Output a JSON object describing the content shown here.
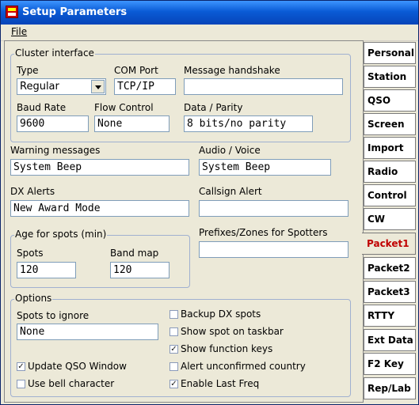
{
  "window": {
    "title": "Setup Parameters"
  },
  "menu": {
    "file": "File"
  },
  "cluster": {
    "group_label": "Cluster interface",
    "type_label": "Type",
    "type_value": "Regular",
    "com_label": "COM Port",
    "com_value": "TCP/IP",
    "handshake_label": "Message handshake",
    "handshake_value": "",
    "baud_label": "Baud Rate",
    "baud_value": "9600",
    "flow_label": "Flow Control",
    "flow_value": "None",
    "parity_label": "Data / Parity",
    "parity_value": "8 bits/no parity"
  },
  "warning": {
    "label": "Warning messages",
    "value": "System Beep"
  },
  "audio": {
    "label": "Audio / Voice",
    "value": "System Beep"
  },
  "dx_alerts": {
    "label": "DX Alerts",
    "value": "New Award Mode"
  },
  "callsign_alert": {
    "label": "Callsign Alert",
    "value": ""
  },
  "age": {
    "group_label": "Age for spots (min)",
    "spots_label": "Spots",
    "spots_value": "120",
    "bandmap_label": "Band map",
    "bandmap_value": "120"
  },
  "prefixes": {
    "label": "Prefixes/Zones for Spotters",
    "value": ""
  },
  "options": {
    "group_label": "Options",
    "ignore_label": "Spots to ignore",
    "ignore_value": "None",
    "backup": {
      "label": "Backup DX spots",
      "checked": false
    },
    "taskbar": {
      "label": "Show spot on taskbar",
      "checked": false
    },
    "function_keys": {
      "label": "Show function keys",
      "checked": true
    },
    "update_qso": {
      "label": "Update QSO Window",
      "checked": true
    },
    "alert_unconfirmed": {
      "label": "Alert unconfirmed country",
      "checked": false
    },
    "bell": {
      "label": "Use bell character",
      "checked": false
    },
    "last_freq": {
      "label": "Enable Last Freq",
      "checked": true
    }
  },
  "tabs": [
    "Personal",
    "Station",
    "QSO",
    "Screen",
    "Import",
    "Radio",
    "Control",
    "CW",
    "Packet1",
    "Packet2",
    "Packet3",
    "RTTY",
    "Ext Data",
    "F2 Key",
    "Rep/Lab"
  ],
  "active_tab": "Packet1",
  "colors": {
    "titlebar": "#0a5bd6",
    "active_tab_text": "#c00000",
    "background": "#ece9d8"
  }
}
